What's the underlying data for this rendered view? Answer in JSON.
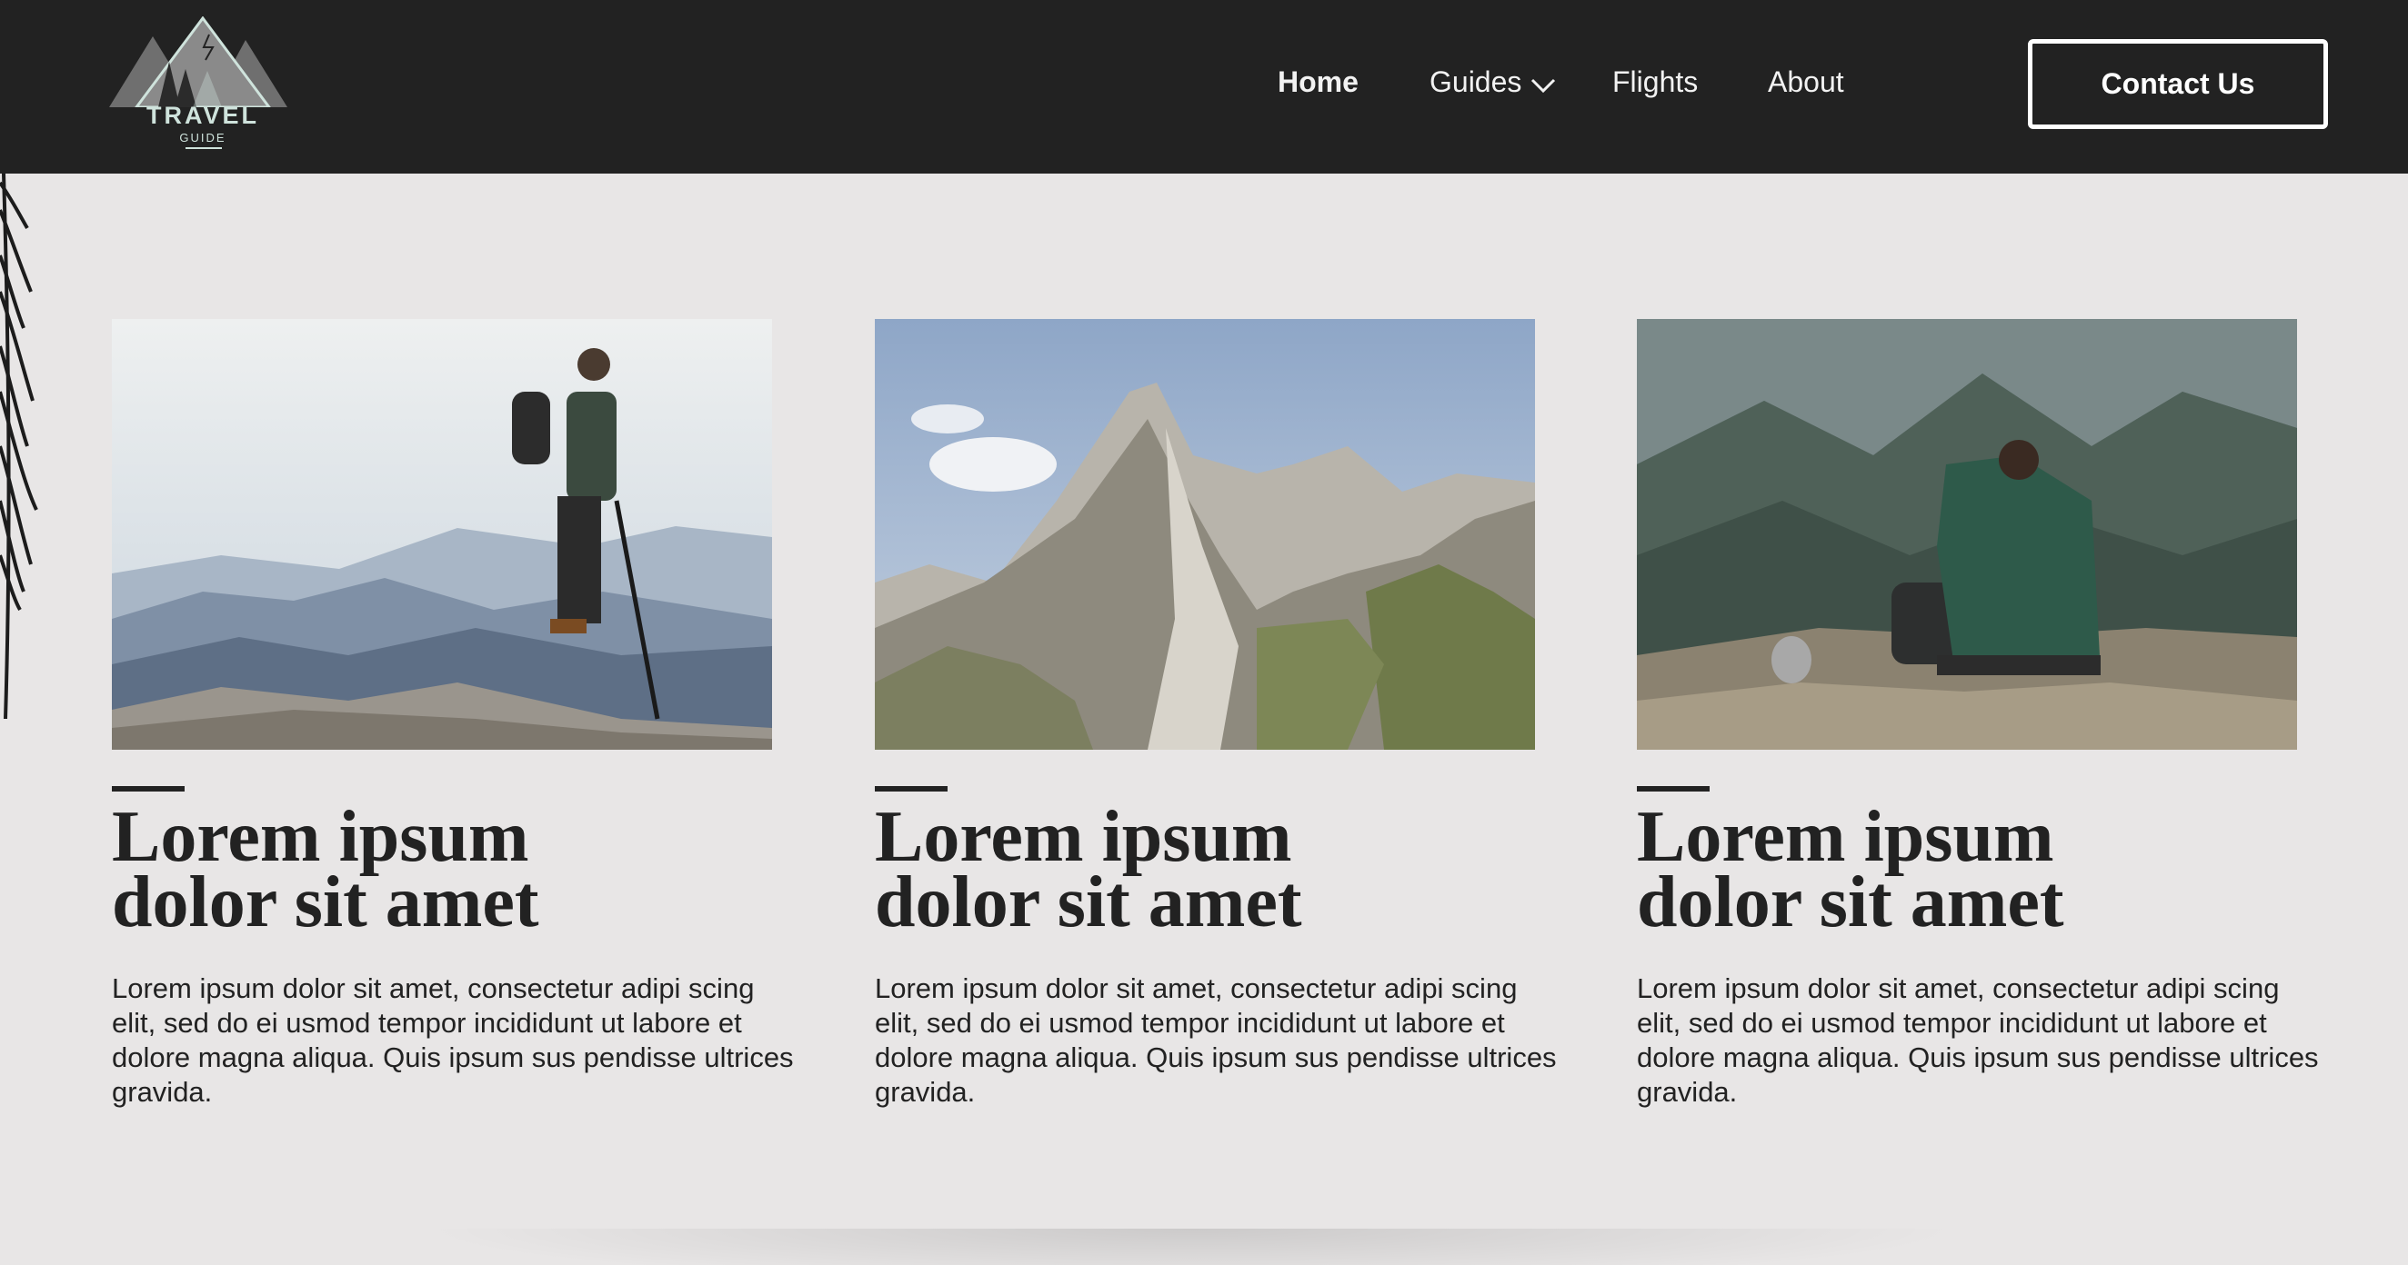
{
  "header": {
    "logo": {
      "title": "TRAVEL",
      "subtitle": "GUIDE"
    },
    "nav": [
      {
        "label": "Home",
        "active": true
      },
      {
        "label": "Guides",
        "has_dropdown": true
      },
      {
        "label": "Flights"
      },
      {
        "label": "About"
      }
    ],
    "contact_label": "Contact Us"
  },
  "cards": [
    {
      "image": "hiker-standing-mountain-ridge-photo",
      "title_line1": "Lorem ipsum",
      "title_line2": "dolor sit amet",
      "text": "Lorem ipsum dolor sit amet, consectetur adipi scing elit, sed do ei usmod tempor incididunt ut labore et dolore magna aliqua. Quis ipsum sus pendisse ultrices gravida."
    },
    {
      "image": "rocky-mountain-peak-photo",
      "title_line1": "Lorem ipsum",
      "title_line2": "dolor sit amet",
      "text": "Lorem ipsum dolor sit amet, consectetur adipi scing elit, sed do ei usmod tempor incididunt ut labore et dolore magna aliqua. Quis ipsum sus pendisse ultrices gravida."
    },
    {
      "image": "hiker-sitting-overlooking-valley-photo",
      "title_line1": "Lorem ipsum",
      "title_line2": "dolor sit amet",
      "text": "Lorem ipsum dolor sit amet, consectetur adipi scing elit, sed do ei usmod tempor incididunt ut labore et dolore magna aliqua. Quis ipsum sus pendisse ultrices gravida."
    }
  ],
  "colors": {
    "header_bg": "#222222",
    "page_bg": "#e8e6e6",
    "text": "#222222",
    "logo_accent": "#cfe3dc"
  }
}
